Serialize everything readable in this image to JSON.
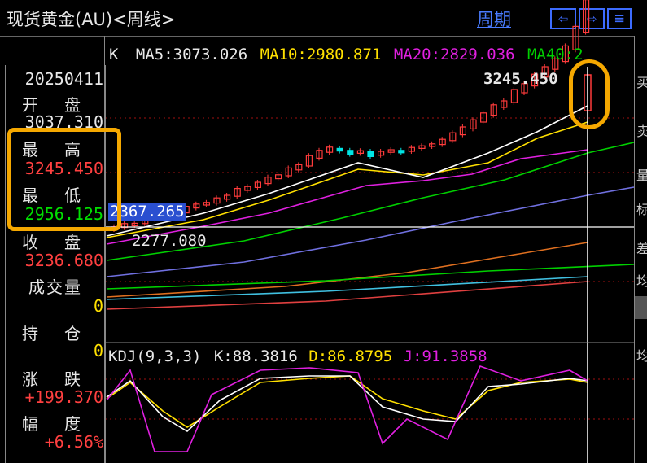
{
  "header": {
    "title": "现货黄金(AU)<周线>",
    "period_label": "周期",
    "nav_left": "⇦",
    "nav_right": "⇨",
    "nav_menu": "≡"
  },
  "legend_main": {
    "k_label": "K",
    "ma5": "MA5:3073.026",
    "ma10": "MA10:2980.871",
    "ma20": "MA20:2829.036",
    "ma40": "MA40:2",
    "high_mark": "3245.450",
    "cursor_price": "2367.265",
    "low_mark": "2277.080"
  },
  "legend_kdj": {
    "name": "KDJ(9,3,3)",
    "k": "K:88.3816",
    "d": "D:86.8795",
    "j": "J:91.3858"
  },
  "info_panel": {
    "date": "20250411",
    "open_label": "开 盘",
    "open_value": "3037.310",
    "high_label": "最 高",
    "high_value": "3245.450",
    "low_label": "最 低",
    "low_value": "2956.125",
    "close_label": "收 盘",
    "close_value": "3236.680",
    "volume_label": "成交量",
    "volume_value": "0",
    "position_label": "持 仓",
    "position_value": "0",
    "change_label": "涨 跌",
    "change_value": "+199.370",
    "pct_label": "幅 度",
    "pct_value": "+6.56%"
  },
  "right_strip": [
    "买",
    "卖",
    "量",
    "标",
    "差",
    "均",
    "均"
  ],
  "colors": {
    "up": "#ff3b3b",
    "down": "#00e5e5",
    "ma5": "#ffffff",
    "ma10": "#ffe000",
    "ma20": "#e020e0",
    "ma40": "#00d000",
    "value_red": "#ff4040",
    "value_green": "#00e000",
    "value_yellow": "#ffe000",
    "highlight": "#f5a800",
    "nav_blue": "#3d6cff"
  },
  "chart_data": {
    "type": "line",
    "title": "现货黄金(AU)<周线>",
    "last_candle": {
      "date": "20250411",
      "open": 3037.31,
      "high": 3245.45,
      "low": 2956.125,
      "close": 3236.68
    },
    "visible_high": 3245.45,
    "visible_low": 2277.08,
    "moving_averages": [
      {
        "name": "MA5",
        "value": 3073.026
      },
      {
        "name": "MA10",
        "value": 2980.871
      },
      {
        "name": "MA20",
        "value": 2829.036
      }
    ],
    "kdj": {
      "K": 88.3816,
      "D": 86.8795,
      "J": 91.3858
    }
  }
}
